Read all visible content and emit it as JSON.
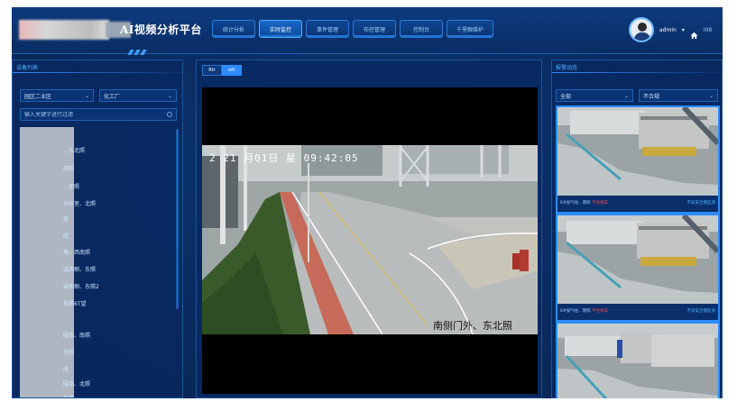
{
  "header": {
    "app_title": "AI视频分析平台",
    "nav_tabs": [
      {
        "label": "统计分析",
        "active": false
      },
      {
        "label": "实时监控",
        "active": true
      },
      {
        "label": "事件管理",
        "active": false
      },
      {
        "label": "布控管理",
        "active": false
      },
      {
        "label": "控制台",
        "active": false
      },
      {
        "label": "千里眼维护",
        "active": false
      }
    ],
    "username": "admin",
    "caret": "▾",
    "home_label": "I08"
  },
  "left_panel": {
    "title": "设备列表",
    "area_select": "园区二业区",
    "plant_select": "化工厂",
    "search_placeholder": "输入关键字进行过滤",
    "devices": [
      "、东北照",
      "西照",
      "、南照",
      "分析室、北照",
      "室",
      "照",
      "角、西南照",
      "道西侧、东照",
      "道西侧、东照2",
      "东照6T望",
      "",
      "围墙、南照",
      "北照",
      "照",
      "围墙、北照",
      "东照"
    ]
  },
  "center_panel": {
    "toggle_a": "Rtr",
    "toggle_b": "wfr",
    "video_timestamp": "2 21  月01日  星   09:42:05",
    "video_location": "南侧门外、东北照"
  },
  "right_panel": {
    "title": "报警动态",
    "filter_all": "全部",
    "filter_status": "不合规",
    "alerts": [
      {
        "left": "6#加气柱、南照",
        "highlight": "不合规车",
        "right": "不穿安全帽监测"
      },
      {
        "left": "6#加气柱、南照",
        "highlight": "不合规车",
        "right": "不穿安全帽监测"
      },
      {
        "left": "",
        "highlight": "",
        "right": ""
      }
    ]
  },
  "colors": {
    "background": "#0a2a5e",
    "accent": "#2d8cff",
    "alert_highlight": "#ff4d4d"
  }
}
